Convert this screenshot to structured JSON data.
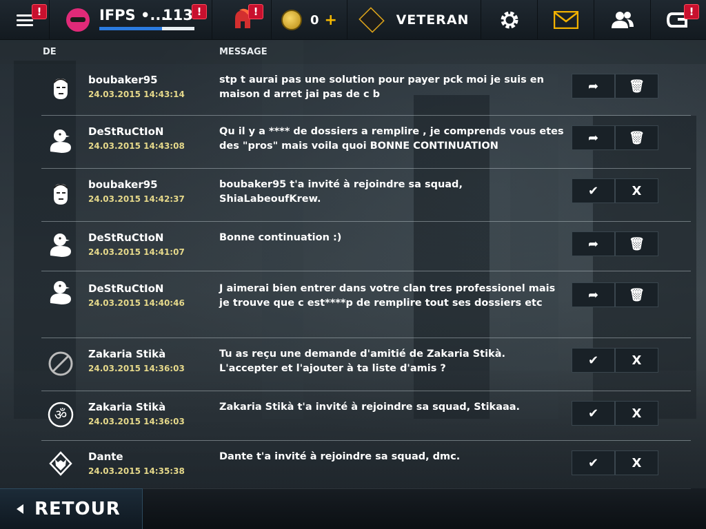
{
  "topbar": {
    "player_name": "IFPS •...",
    "player_level": "113",
    "xp_fraction": 0.66,
    "alert_mark": "!",
    "coins": "0",
    "plus_symbol": "+",
    "rank_title": "VETERAN",
    "colors": {
      "alert": "#c8102e",
      "xp": "#2b7be0",
      "gold": "#f5b800",
      "mail": "#f2b200"
    }
  },
  "columns": {
    "from": "DE",
    "message": "MESSAGE"
  },
  "messages": [
    {
      "sender": "boubaker95",
      "date": "24.03.2015 14:43:14",
      "text": "stp t aurai pas une solution pour payer pck moi je suis en maison d arret jai pas de c b",
      "icon": "soldier-avatar-icon",
      "actions": [
        "forward",
        "delete"
      ]
    },
    {
      "sender": "DeStRuCtIoN",
      "date": "24.03.2015 14:43:08",
      "text": "Qu il y a **** de dossiers a remplire , je comprends  vous etes des \"pros\" mais voila quoi BONNE CONTINUATION",
      "icon": "duck-avatar-icon",
      "actions": [
        "forward",
        "delete"
      ]
    },
    {
      "sender": "boubaker95",
      "date": "24.03.2015 14:42:37",
      "text": "boubaker95 t'a invité à rejoindre sa squad, ShiaLabeoufKrew.",
      "icon": "soldier-avatar-icon",
      "actions": [
        "accept",
        "decline"
      ]
    },
    {
      "sender": "DeStRuCtIoN",
      "date": "24.03.2015 14:41:07",
      "text": "Bonne continuation :)",
      "icon": "duck-avatar-icon",
      "actions": [
        "forward",
        "delete"
      ]
    },
    {
      "sender": "DeStRuCtIoN",
      "date": "24.03.2015 14:40:46",
      "text": "J aimerai bien entrer dans votre clan tres professionel mais je  trouve que c est****p de remplire tout ses dossiers etc",
      "icon": "duck-avatar-icon",
      "actions": [
        "forward",
        "delete"
      ]
    },
    {
      "sender": "Zakaria Stikà",
      "date": "24.03.2015 14:36:03",
      "text": "Tu as reçu une demande d'amitié de Zakaria Stikà. L'accepter et l'ajouter à ta liste d'amis ?",
      "icon": "no-avatar-icon",
      "actions": [
        "accept",
        "decline"
      ]
    },
    {
      "sender": "Zakaria Stikà",
      "date": "24.03.2015 14:36:03",
      "text": "Zakaria Stikà t'a invité à rejoindre sa squad, Stikaaa.",
      "icon": "om-emblem-icon",
      "actions": [
        "accept",
        "decline"
      ]
    },
    {
      "sender": "Dante",
      "date": "24.03.2015 14:35:38",
      "text": "Dante t'a invité à rejoindre sa squad, dmc.",
      "icon": "wolf-emblem-icon",
      "actions": [
        "accept",
        "decline"
      ]
    }
  ],
  "action_glyphs": {
    "forward": "➦",
    "delete": "🗑",
    "accept": "✔",
    "decline": "X"
  },
  "footer": {
    "back_label": "RETOUR"
  }
}
